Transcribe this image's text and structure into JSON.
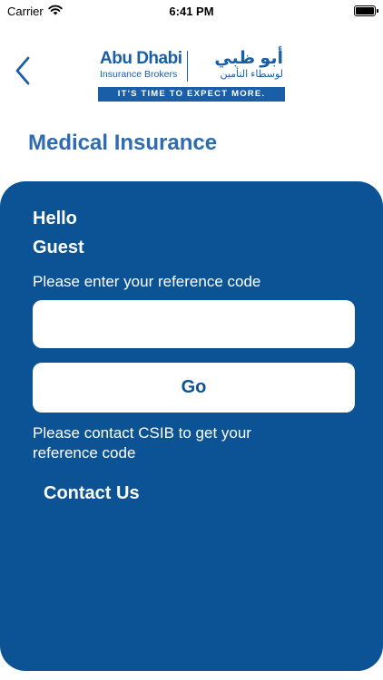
{
  "status_bar": {
    "carrier": "Carrier",
    "time": "6:41 PM"
  },
  "header": {
    "back_icon": "chevron-left-icon",
    "logo": {
      "brand_en": "Abu Dhabi",
      "sub_en": "Insurance Brokers",
      "brand_ar": "أبو ظبي",
      "sub_ar": "لوسطاء التأمين",
      "tagline": "IT'S TIME TO EXPECT MORE."
    }
  },
  "page_title": "Medical Insurance",
  "card": {
    "greeting_line1": "Hello",
    "greeting_line2": "Guest",
    "prompt": "Please enter your reference code",
    "reference_input": {
      "value": "",
      "placeholder": ""
    },
    "go_label": "Go",
    "contact_text": "Please contact CSIB to get your reference code",
    "contact_link": "Contact Us"
  },
  "colors": {
    "brand_blue": "#1a5ea8",
    "card_blue": "#0b5395",
    "title_blue": "#2e6bb0"
  }
}
